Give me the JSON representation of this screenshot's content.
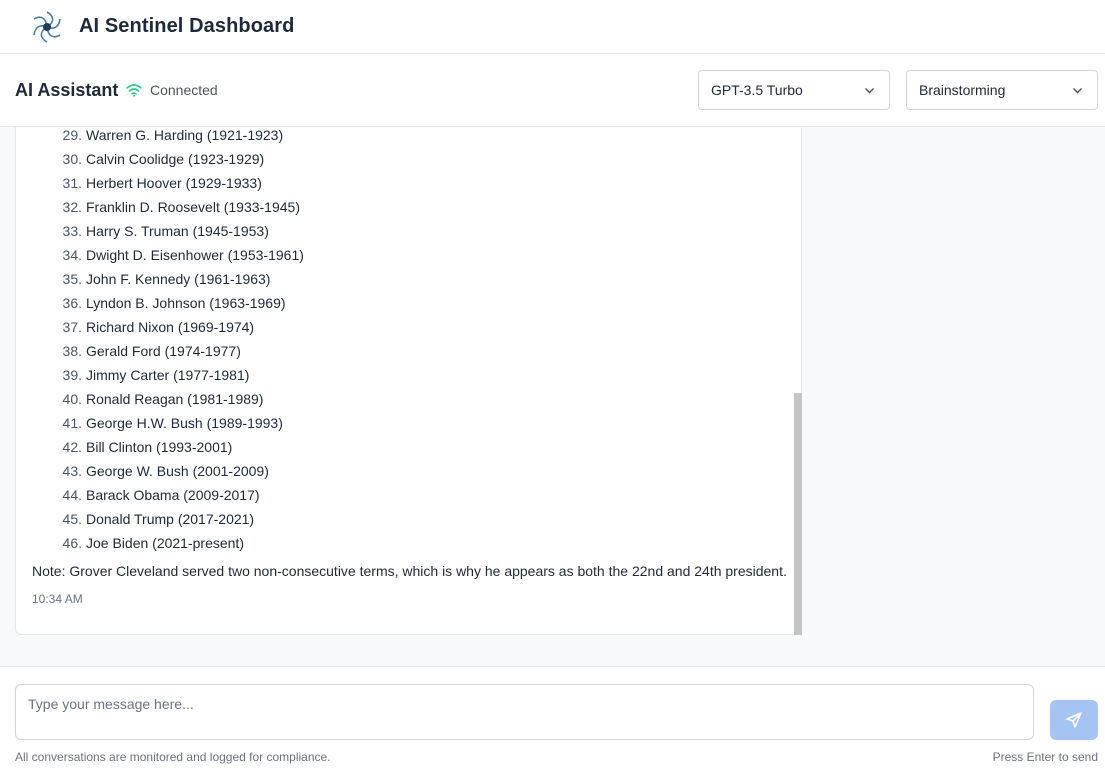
{
  "app": {
    "title": "AI Sentinel Dashboard"
  },
  "header": {
    "title": "AI Assistant",
    "status": "Connected",
    "model_select": {
      "value": "GPT-3.5 Turbo"
    },
    "mode_select": {
      "value": "Brainstorming"
    }
  },
  "message": {
    "items": [
      {
        "num": "29.",
        "text": "Warren G. Harding (1921-1923)"
      },
      {
        "num": "30.",
        "text": "Calvin Coolidge (1923-1929)"
      },
      {
        "num": "31.",
        "text": "Herbert Hoover (1929-1933)"
      },
      {
        "num": "32.",
        "text": "Franklin D. Roosevelt (1933-1945)"
      },
      {
        "num": "33.",
        "text": "Harry S. Truman (1945-1953)"
      },
      {
        "num": "34.",
        "text": "Dwight D. Eisenhower (1953-1961)"
      },
      {
        "num": "35.",
        "text": "John F. Kennedy (1961-1963)"
      },
      {
        "num": "36.",
        "text": "Lyndon B. Johnson (1963-1969)"
      },
      {
        "num": "37.",
        "text": "Richard Nixon (1969-1974)"
      },
      {
        "num": "38.",
        "text": "Gerald Ford (1974-1977)"
      },
      {
        "num": "39.",
        "text": "Jimmy Carter (1977-1981)"
      },
      {
        "num": "40.",
        "text": "Ronald Reagan (1981-1989)"
      },
      {
        "num": "41.",
        "text": "George H.W. Bush (1989-1993)"
      },
      {
        "num": "42.",
        "text": "Bill Clinton (1993-2001)"
      },
      {
        "num": "43.",
        "text": "George W. Bush (2001-2009)"
      },
      {
        "num": "44.",
        "text": "Barack Obama (2009-2017)"
      },
      {
        "num": "45.",
        "text": "Donald Trump (2017-2021)"
      },
      {
        "num": "46.",
        "text": "Joe Biden (2021-present)"
      }
    ],
    "note": "Note: Grover Cleveland served two non-consecutive terms, which is why he appears as both the 22nd and 24th president.",
    "time": "10:34 AM"
  },
  "composer": {
    "placeholder": "Type your message here...",
    "footer_left": "All conversations are monitored and logged for compliance.",
    "footer_right": "Press Enter to send"
  },
  "colors": {
    "accent": "#a6c4f3",
    "status": "#34c38f",
    "logo": "#4a7fa3"
  },
  "icons": {
    "logo": "aperture-logo-icon",
    "status": "wifi-icon",
    "dropdown": "chevron-down-icon",
    "send": "send-icon"
  }
}
